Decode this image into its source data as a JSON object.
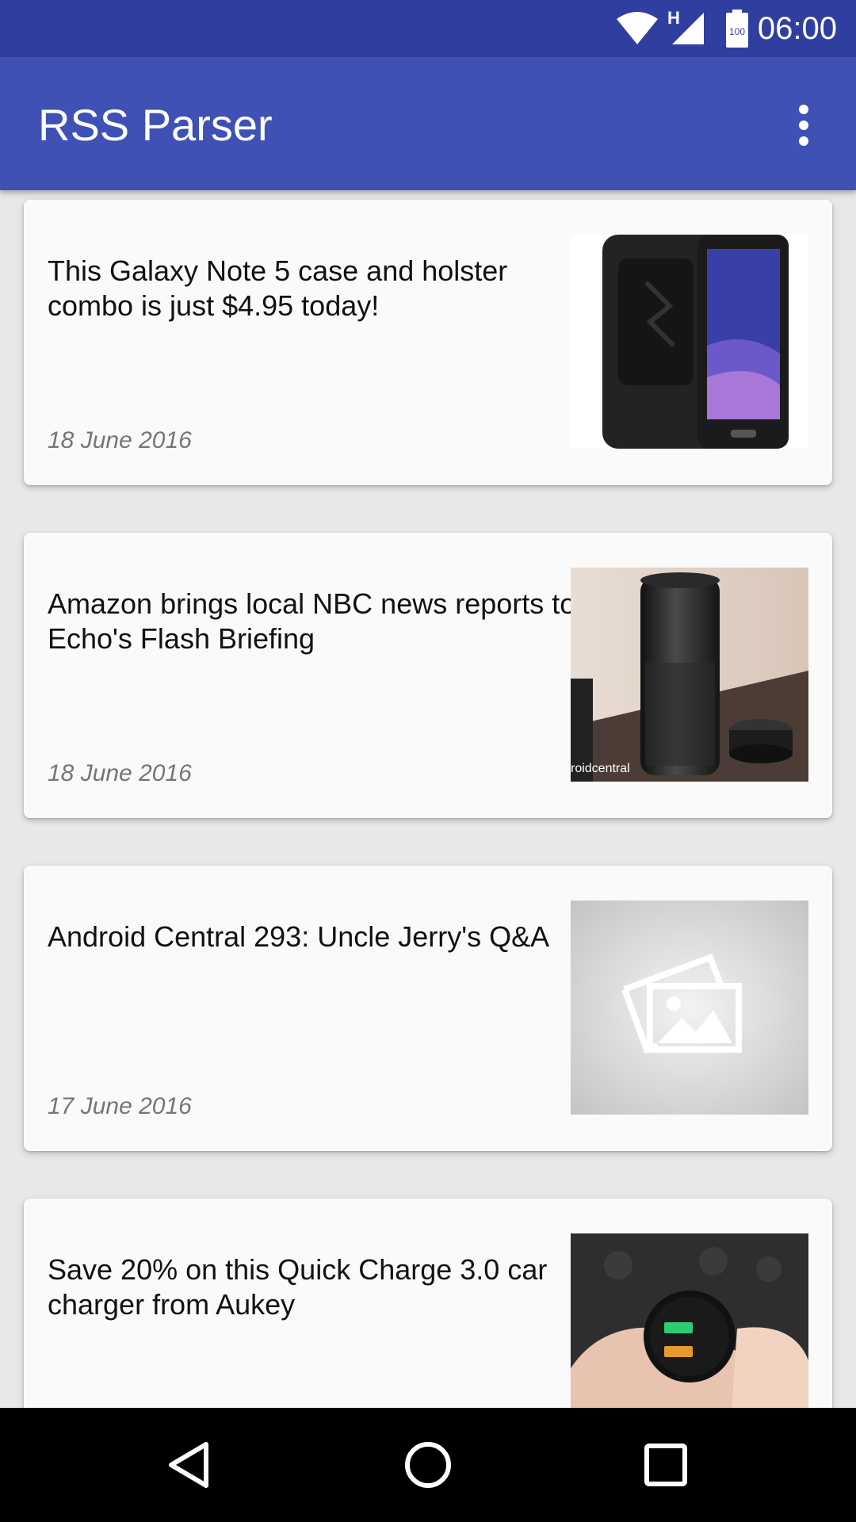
{
  "status_bar": {
    "time": "06:00",
    "network_type": "H",
    "battery_level": "100",
    "icons": [
      "wifi-icon",
      "cellular-signal-icon",
      "battery-icon"
    ],
    "background_color": "#303f9f"
  },
  "app_bar": {
    "title": "RSS Parser",
    "overflow_icon": "more-vert-icon",
    "background_color": "#3f51b5"
  },
  "feed": {
    "items": [
      {
        "title": "This Galaxy Note 5 case and holster combo is just $4.95 today!",
        "date": "18 June 2016",
        "image": "phone-holster-photo"
      },
      {
        "title": "Amazon brings local NBC news reports to Echo's Flash Briefing",
        "date": "18 June 2016",
        "image": "amazon-echo-photo",
        "image_caption": "roidcentral"
      },
      {
        "title": "Android Central 293: Uncle Jerry's Q&A",
        "date": "17 June 2016",
        "image": "image-placeholder-icon"
      },
      {
        "title": "Save 20% on this Quick Charge 3.0 car charger from Aukey",
        "date": "",
        "image": "car-charger-photo"
      }
    ]
  },
  "nav_bar": {
    "buttons": [
      "back-icon",
      "home-icon",
      "recents-icon"
    ]
  }
}
